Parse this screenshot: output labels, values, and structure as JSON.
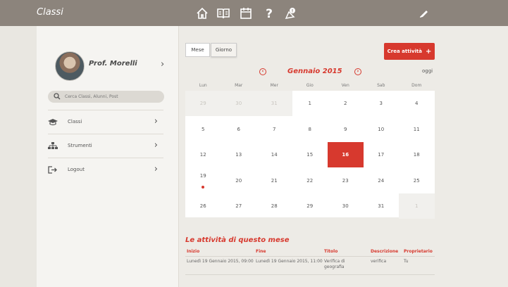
{
  "app": {
    "title": "Classi"
  },
  "nav_icons": [
    "home-icon",
    "book-icon",
    "calendar-icon",
    "help-icon",
    "badge-icon",
    "pencil-icon"
  ],
  "profile": {
    "name": "Prof. Morelli"
  },
  "search": {
    "placeholder": "Cerca Classi, Alunni, Post"
  },
  "sidebar": {
    "items": [
      {
        "label": "Classi",
        "icon": "graduation-cap-icon"
      },
      {
        "label": "Strumenti",
        "icon": "tools-icon"
      },
      {
        "label": "Logout",
        "icon": "logout-icon"
      }
    ]
  },
  "tabs": {
    "month": "Mese",
    "day": "Giorno"
  },
  "create_button": {
    "label": "Crea attività",
    "icon": "plus"
  },
  "calendar": {
    "month_label": "Gennaio 2015",
    "today_label": "oggi",
    "weekdays": [
      "Lun",
      "Mar",
      "Mer",
      "Gio",
      "Ven",
      "Sab",
      "Dom"
    ],
    "weeks": [
      [
        "29",
        "30",
        "31",
        "1",
        "2",
        "3",
        "4"
      ],
      [
        "5",
        "6",
        "7",
        "8",
        "9",
        "10",
        "11"
      ],
      [
        "12",
        "13",
        "14",
        "15",
        "16",
        "17",
        "18"
      ],
      [
        "19",
        "20",
        "21",
        "22",
        "23",
        "24",
        "25"
      ],
      [
        "26",
        "27",
        "28",
        "29",
        "30",
        "31",
        "1"
      ]
    ],
    "selected_day": "16",
    "event_day": "19",
    "accent": "#d7392e"
  },
  "activities": {
    "title": "Le attività di questo mese",
    "columns": [
      "Inizio",
      "Fine",
      "Titolo",
      "Descrizione",
      "Proprietario"
    ],
    "rows": [
      [
        "Lunedì 19 Gennaio 2015, 09:00",
        "Lunedì 19 Gennaio 2015, 11:00",
        "Verifica di geografia",
        "verifica",
        "Tu"
      ]
    ]
  }
}
